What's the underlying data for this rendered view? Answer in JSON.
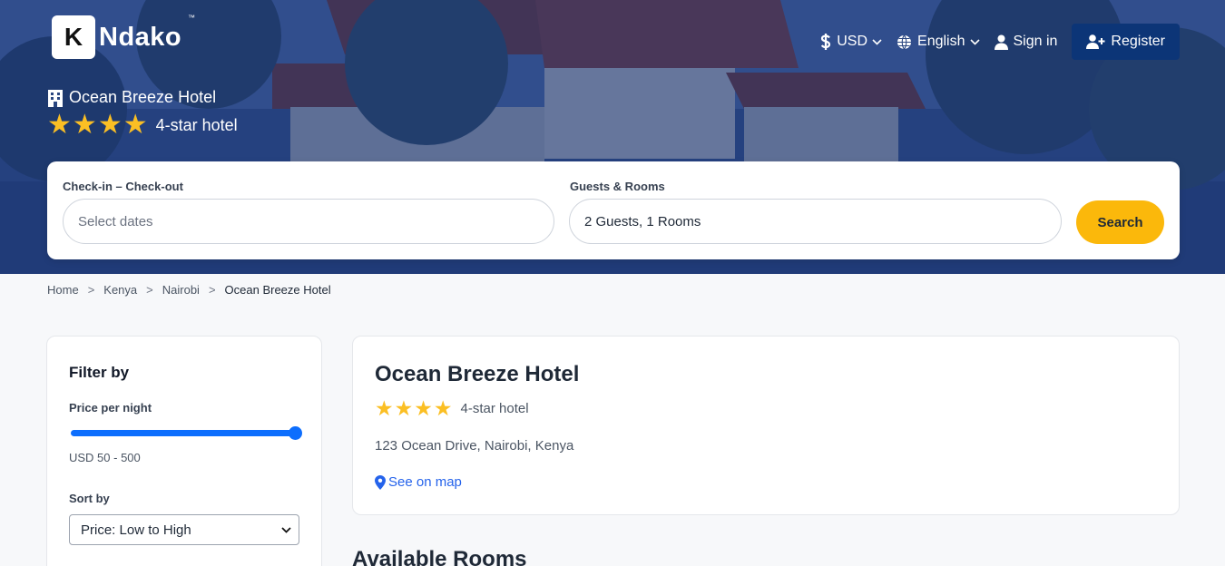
{
  "brand": {
    "logo_letter": "K",
    "logo_text": "Ndako",
    "tm": "™"
  },
  "nav": {
    "currency": "USD",
    "language": "English",
    "sign_in": "Sign in",
    "register": "Register"
  },
  "hero": {
    "hotel_name": "Ocean Breeze Hotel",
    "star_label": "4-star hotel"
  },
  "search": {
    "dates_label": "Check-in – Check-out",
    "dates_placeholder": "Select dates",
    "guests_label": "Guests & Rooms",
    "guests_value": "2 Guests, 1 Rooms",
    "button": "Search"
  },
  "breadcrumb": [
    "Home",
    "Kenya",
    "Nairobi",
    "Ocean Breeze Hotel"
  ],
  "filter": {
    "title": "Filter by",
    "price_label": "Price per night",
    "price_range": "USD 50 - 500",
    "price_min": 50,
    "price_max": 500,
    "sort_label": "Sort by",
    "sort_value": "Price: Low to High"
  },
  "hotel": {
    "name": "Ocean Breeze Hotel",
    "stars": 4,
    "star_label": "4-star hotel",
    "address": "123 Ocean Drive, Nairobi, Kenya",
    "map_link": "See on map"
  },
  "rooms": {
    "heading": "Available Rooms"
  },
  "colors": {
    "primary": "#0c3577",
    "accent": "#fbb80b",
    "star": "#fbbf24",
    "link": "#2563eb",
    "slider": "#0d6efd"
  },
  "icons": [
    "dollar-icon",
    "chevron-down-icon",
    "globe-icon",
    "user-icon",
    "user-plus-icon",
    "hotel-icon",
    "star-icon",
    "map-pin-icon"
  ]
}
